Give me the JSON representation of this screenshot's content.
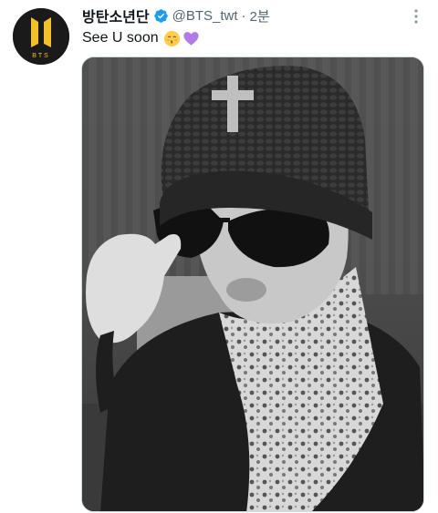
{
  "tweet": {
    "display_name": "방탄소년단",
    "handle": "@BTS_twt",
    "separator": "·",
    "time": "2분",
    "text": "See U soon",
    "emojis": [
      "kissing-face-emoji",
      "purple-heart-emoji"
    ]
  },
  "avatar": {
    "logo_text": "BTS",
    "accent": "#f3c02a",
    "background": "#1a1a1a"
  },
  "colors": {
    "verified": "#1d9bf0",
    "muted": "#536471",
    "text": "#0f1419",
    "heart": "#b07be6"
  },
  "icons": {
    "verified": "verified-badge-icon",
    "more": "more-options-icon"
  },
  "media": {
    "type": "photo"
  }
}
